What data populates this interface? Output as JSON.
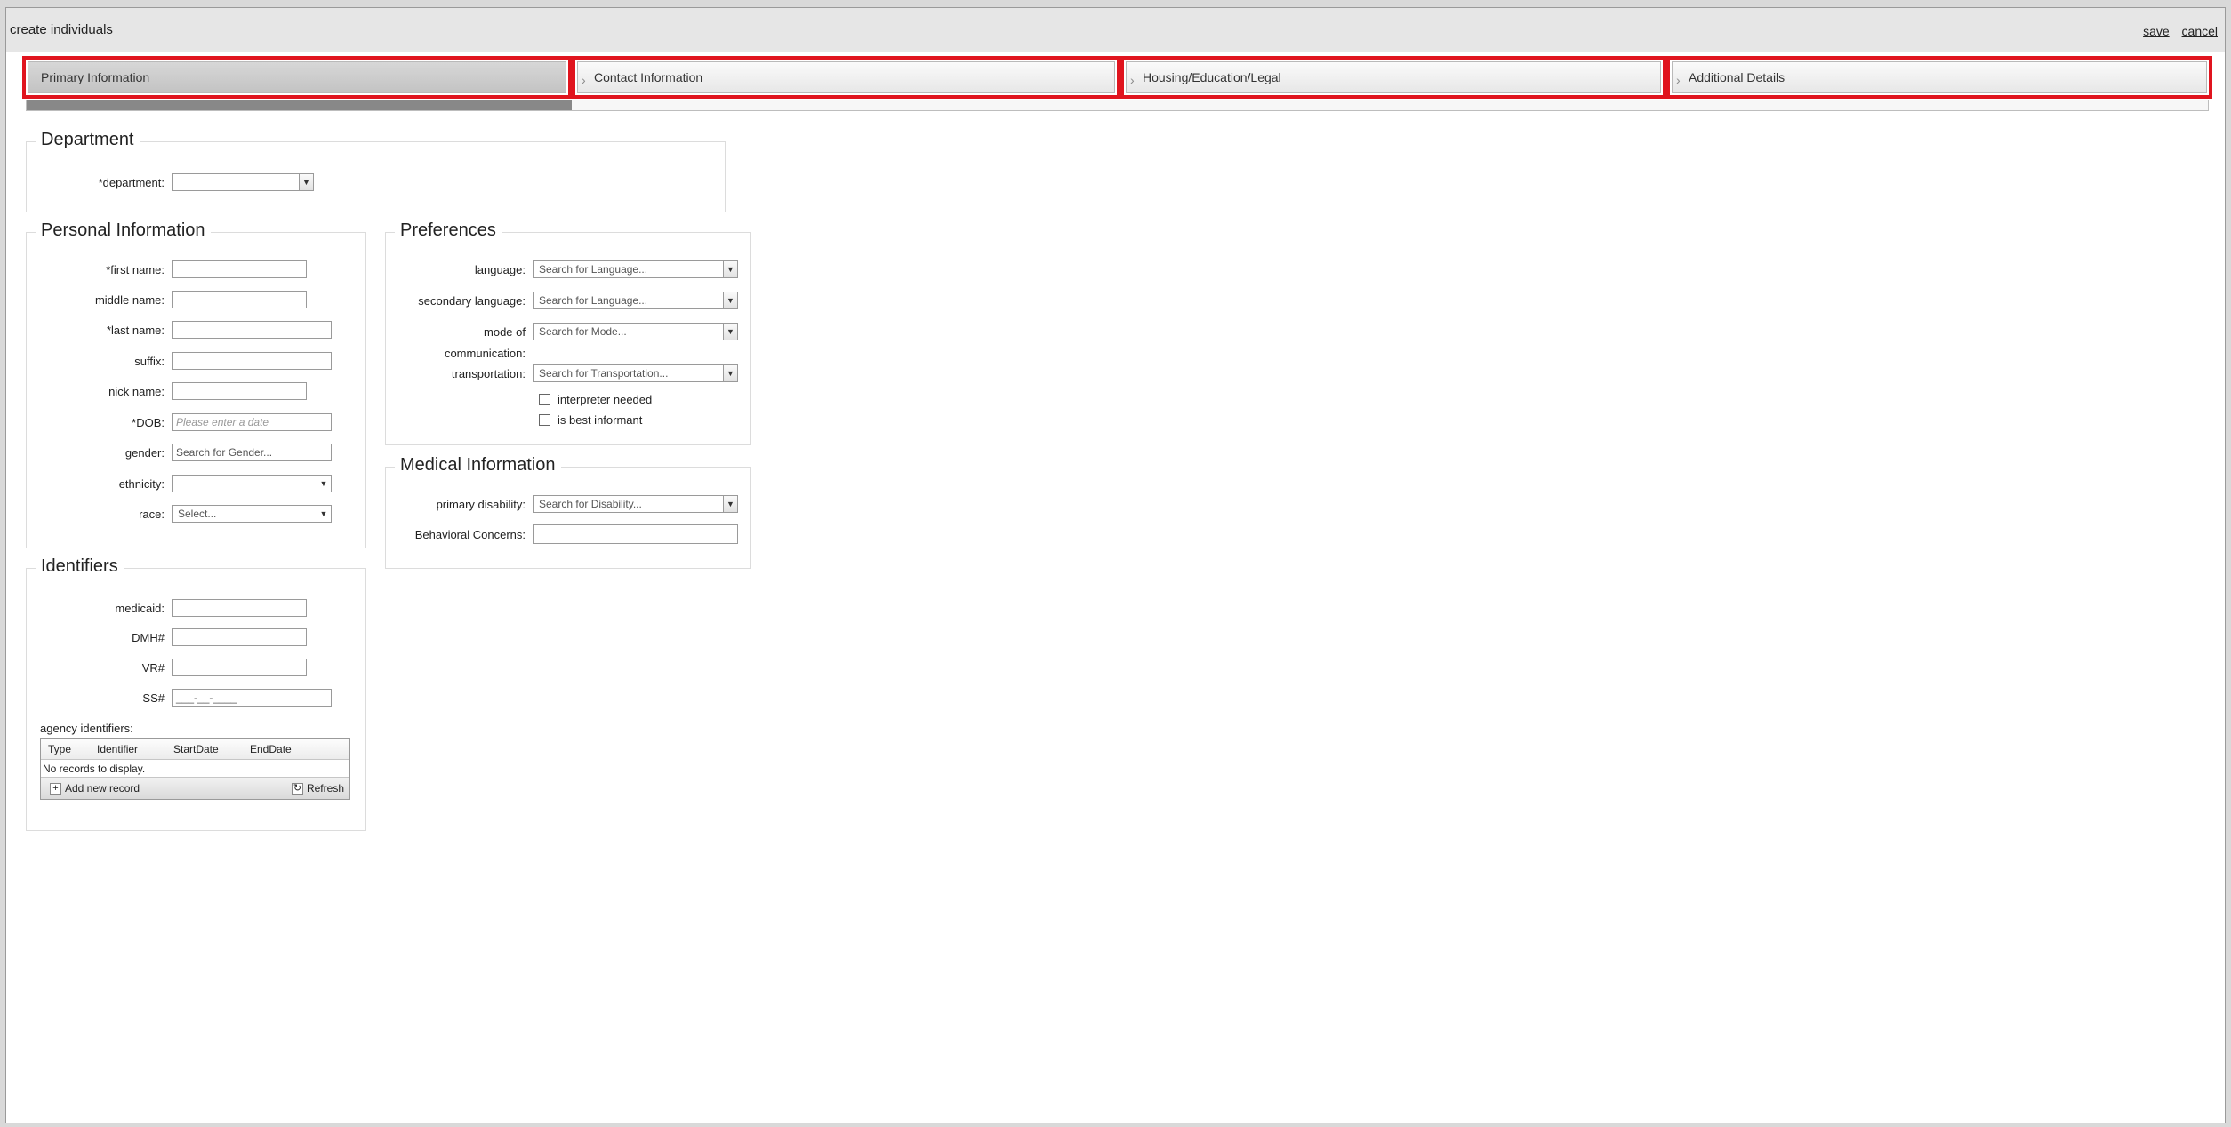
{
  "window": {
    "title": "create individuals",
    "save_label": "save",
    "cancel_label": "cancel"
  },
  "wizard": {
    "steps": [
      {
        "label": "Primary Information"
      },
      {
        "label": "Contact Information"
      },
      {
        "label": "Housing/Education/Legal"
      },
      {
        "label": "Additional Details"
      }
    ],
    "progress_fraction": 0.25
  },
  "department": {
    "legend": "Department",
    "label": "*department:",
    "value": ""
  },
  "personal": {
    "legend": "Personal Information",
    "first_name_label": "*first name:",
    "middle_name_label": "middle name:",
    "last_name_label": "*last name:",
    "suffix_label": "suffix:",
    "nick_name_label": "nick name:",
    "dob_label": "*DOB:",
    "dob_placeholder": "Please enter a date",
    "gender_label": "gender:",
    "gender_placeholder": "Search for Gender...",
    "ethnicity_label": "ethnicity:",
    "ethnicity_value": "",
    "race_label": "race:",
    "race_value": "Select..."
  },
  "identifiers": {
    "legend": "Identifiers",
    "medicaid_label": "medicaid:",
    "dmh_label": "DMH#",
    "vr_label": "VR#",
    "ss_label": "SS#",
    "ss_mask": "___-__-____",
    "agency_label": "agency identifiers:",
    "grid": {
      "columns": [
        "Type",
        "Identifier",
        "StartDate",
        "EndDate"
      ],
      "empty_text": "No records to display.",
      "add_label": "Add new record",
      "refresh_label": "Refresh"
    }
  },
  "preferences": {
    "legend": "Preferences",
    "language_label": "language:",
    "language_placeholder": "Search for Language...",
    "secondary_language_label": "secondary language:",
    "secondary_language_placeholder": "Search for Language...",
    "mode_label_line1": "mode of",
    "mode_label_line2": "communication:",
    "mode_placeholder": "Search for Mode...",
    "transportation_label": "transportation:",
    "transportation_placeholder": "Search for Transportation...",
    "interpreter_label": "interpreter needed",
    "best_informant_label": "is best informant"
  },
  "medical": {
    "legend": "Medical Information",
    "disability_label": "primary disability:",
    "disability_placeholder": "Search for Disability...",
    "behavioral_label": "Behavioral Concerns:"
  }
}
